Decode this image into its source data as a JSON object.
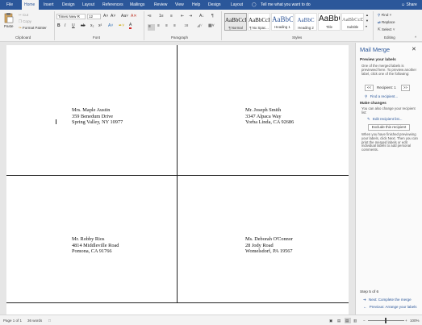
{
  "tabs": [
    {
      "label": "File"
    },
    {
      "label": "Home"
    },
    {
      "label": "Insert"
    },
    {
      "label": "Design"
    },
    {
      "label": "Layout"
    },
    {
      "label": "References"
    },
    {
      "label": "Mailings"
    },
    {
      "label": "Review"
    },
    {
      "label": "View"
    },
    {
      "label": "Help"
    },
    {
      "label": "Design"
    },
    {
      "label": "Layout"
    }
  ],
  "tell_me": "Tell me what you want to do",
  "share": "Share",
  "clipboard": {
    "paste": "Paste",
    "cut": "Cut",
    "copy": "Copy",
    "format_painter": "Format Painter",
    "group": "Clipboard"
  },
  "font": {
    "name": "Times New R",
    "size": "12",
    "group": "Font"
  },
  "paragraph": {
    "group": "Paragraph"
  },
  "styles": {
    "items": [
      {
        "preview": "AaBbCcI",
        "name": "¶ Normal"
      },
      {
        "preview": "AaBbCcI",
        "name": "¶ No Spac..."
      },
      {
        "preview": "AaBbC",
        "name": "Heading 1"
      },
      {
        "preview": "AaBbC",
        "name": "Heading 2"
      },
      {
        "preview": "AaBbC",
        "name": "Title"
      },
      {
        "preview": "AaBbCcD",
        "name": "Subtitle"
      }
    ],
    "group": "Styles"
  },
  "editing": {
    "find": "Find",
    "replace": "Replace",
    "select": "Select",
    "group": "Editing"
  },
  "labels": [
    {
      "line1": "Mrs. Maple Austin",
      "line2": "359 Benedum Drive",
      "line3": "Spring Valley, NY 10977"
    },
    {
      "line1": "Mr. Joseph Smith",
      "line2": "3347 Alpaca Way",
      "line3": "Yorba Linda, CA 92686"
    },
    {
      "line1": "Mr. Robby Rios",
      "line2": "4814 Middleville Road",
      "line3": "Pomona, CA 91766"
    },
    {
      "line1": "Ms. Deborah O'Connor",
      "line2": "28 Jody Road",
      "line3": "Womelsdorf, PA 19567"
    }
  ],
  "pane": {
    "title": "Mail Merge",
    "preview_heading": "Preview your labels",
    "preview_text": "One of the merged labels is previewed here. To preview another label, click one of the following:",
    "prev_btn": "<<",
    "recipient_label": "Recipient: 1",
    "next_btn": ">>",
    "find_recipient": "Find a recipient...",
    "changes_heading": "Make changes",
    "changes_text": "You can also change your recipient list:",
    "edit_list": "Edit recipient list...",
    "exclude": "Exclude this recipient",
    "finish_text": "When you have finished previewing your labels, click Next. Then you can print the merged labels or edit individual labels to add personal comments.",
    "step": "Step 5 of 6",
    "next_step": "Next: Complete the merge",
    "prev_step": "Previous: Arrange your labels"
  },
  "status": {
    "page": "Page 1 of 1",
    "words": "36 words",
    "zoom": "100%"
  }
}
